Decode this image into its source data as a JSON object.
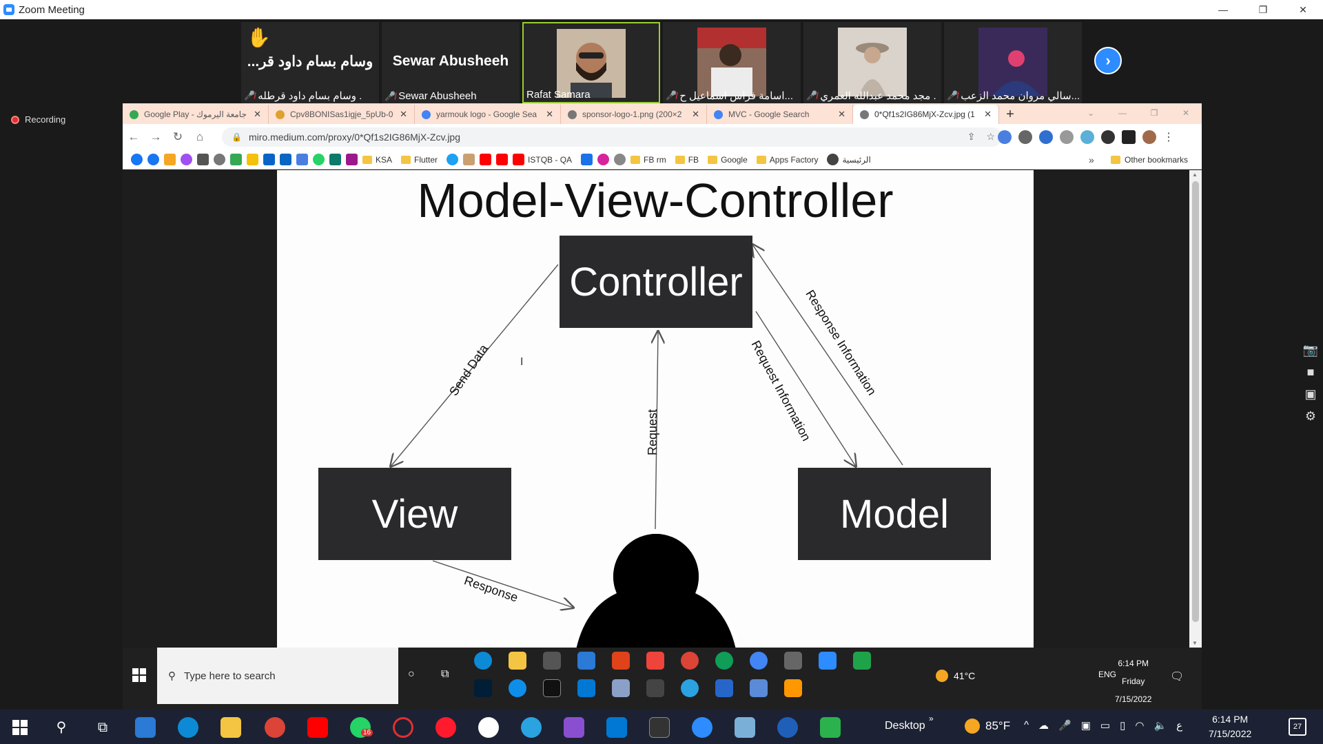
{
  "window": {
    "title": "Zoom Meeting",
    "controls": [
      "—",
      "❐",
      "✕"
    ]
  },
  "participants": [
    {
      "big_name": "...وسام بسام داود قر",
      "name": "وسام بسام داود قرطله .",
      "muted": true,
      "hand_raised": true,
      "video": false
    },
    {
      "big_name": "Sewar Abusheeh",
      "name": "Sewar Abusheeh",
      "muted": true,
      "hand_raised": false,
      "video": false
    },
    {
      "big_name": "",
      "name": "Rafat Samara",
      "muted": false,
      "active_speaker": true,
      "video": true
    },
    {
      "big_name": "",
      "name": "اسامة فراس اسماعيل ح...",
      "muted": true,
      "video": true
    },
    {
      "big_name": "",
      "name": "مجد محمد عبدالله العمري .",
      "muted": true,
      "video": true
    },
    {
      "big_name": "",
      "name": "سالي مروان محمد الزعب...",
      "muted": true,
      "video": true
    }
  ],
  "next_page_icon": "chevron-right-icon",
  "recording": {
    "label": "Recording"
  },
  "browser": {
    "tabs": [
      {
        "title": "Google Play - جامعة اليرموك",
        "color": "#34a853",
        "active": false
      },
      {
        "title": "Cpv8BONISas1igje_5pUb-0",
        "color": "#e0a030",
        "active": false
      },
      {
        "title": "yarmouk logo - Google Sea",
        "color": "#4285f4",
        "active": false
      },
      {
        "title": "sponsor-logo-1.png (200×2",
        "color": "#777777",
        "active": false
      },
      {
        "title": "MVC - Google Search",
        "color": "#4285f4",
        "active": false
      },
      {
        "title": "0*Qf1s2IG86MjX-Zcv.jpg (1",
        "color": "#777777",
        "active": true
      }
    ],
    "new_tab": "+",
    "url": "miro.medium.com/proxy/0*Qf1s2IG86MjX-Zcv.jpg",
    "bookmarks": [
      {
        "label": "KSA",
        "folder": true
      },
      {
        "label": "Flutter",
        "folder": true
      },
      {
        "label": "ISTQB - QA",
        "folder": false
      },
      {
        "label": "FB rm",
        "folder": true
      },
      {
        "label": "FB",
        "folder": true
      },
      {
        "label": "Google",
        "folder": true
      },
      {
        "label": "Apps Factory",
        "folder": true
      },
      {
        "label": "الرئيسية",
        "folder": false
      }
    ],
    "bookmarks_more": "»",
    "other_bookmarks": "Other bookmarks"
  },
  "slide": {
    "title": "Model-View-Controller",
    "controller": "Controller",
    "view": "View",
    "model": "Model",
    "labels": {
      "send_data": "Send Data",
      "request": "Request",
      "request_information": "Request Information",
      "response_information": "Response Information",
      "response": "Response"
    }
  },
  "shared_taskbar": {
    "search_placeholder": "Type here to search",
    "weather": "41°C",
    "lang": "ENG",
    "time": "6:14 PM",
    "day": "Friday",
    "date": "7/15/2022"
  },
  "taskbar": {
    "desktop_label": "Desktop",
    "weather": "85°F",
    "time": "6:14 PM",
    "date": "7/15/2022",
    "notifications": "27",
    "whatsapp_badge": "16"
  }
}
